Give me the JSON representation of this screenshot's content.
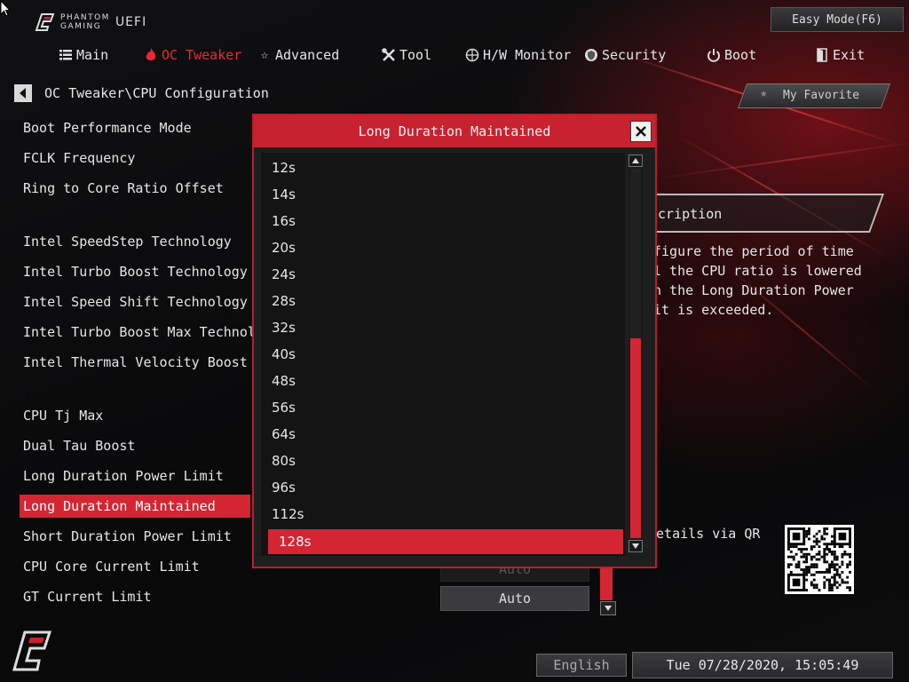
{
  "header": {
    "brand_line1": "PHANTOM",
    "brand_line2": "GAMING",
    "brand_suffix": "UEFI",
    "easy_mode": "Easy Mode(F6)"
  },
  "nav": {
    "items": [
      {
        "label": "Main",
        "icon": "list-icon"
      },
      {
        "label": "OC Tweaker",
        "icon": "flame-icon",
        "active": true
      },
      {
        "label": "Advanced",
        "icon": "star-icon"
      },
      {
        "label": "Tool",
        "icon": "tools-icon"
      },
      {
        "label": "H/W Monitor",
        "icon": "monitor-icon"
      },
      {
        "label": "Security",
        "icon": "shield-icon"
      },
      {
        "label": "Boot",
        "icon": "power-icon"
      },
      {
        "label": "Exit",
        "icon": "exit-icon"
      }
    ]
  },
  "breadcrumb": "OC Tweaker\\CPU Configuration",
  "favorite": "My Favorite",
  "options": [
    "Boot Performance Mode",
    "FCLK Frequency",
    "Ring to Core Ratio Offset",
    "Intel SpeedStep Technology",
    "Intel Turbo Boost Technology",
    "Intel Speed Shift Technology",
    "Intel Turbo Boost Max Technolog",
    "Intel Thermal Velocity Boost Vol",
    "CPU Tj Max",
    "Dual Tau Boost",
    "Long Duration Power Limit",
    "Long Duration Maintained",
    "Short Duration Power Limit",
    "CPU Core Current Limit",
    "GT Current Limit"
  ],
  "selected_option_index": 11,
  "values": {
    "cpu_core_current_limit": "Auto",
    "gt_current_limit": "Auto"
  },
  "description": {
    "title": "scription",
    "text": "figure the period of time\nl the CPU ratio is lowered\nn the Long Duration Power\nit is exceeded."
  },
  "qr_text": "details via QR",
  "popup": {
    "title": "Long Duration Maintained",
    "items": [
      "12s",
      "14s",
      "16s",
      "20s",
      "24s",
      "28s",
      "32s",
      "40s",
      "48s",
      "56s",
      "64s",
      "80s",
      "96s",
      "112s",
      "128s"
    ],
    "selected_index": 14,
    "scroll_thumb_start": 0.46,
    "scroll_thumb_end": 1.0
  },
  "footer": {
    "language": "English",
    "datetime": "Tue 07/28/2020, 15:05:49"
  },
  "colors": {
    "accent": "#d42532",
    "header_red": "#c82230"
  }
}
